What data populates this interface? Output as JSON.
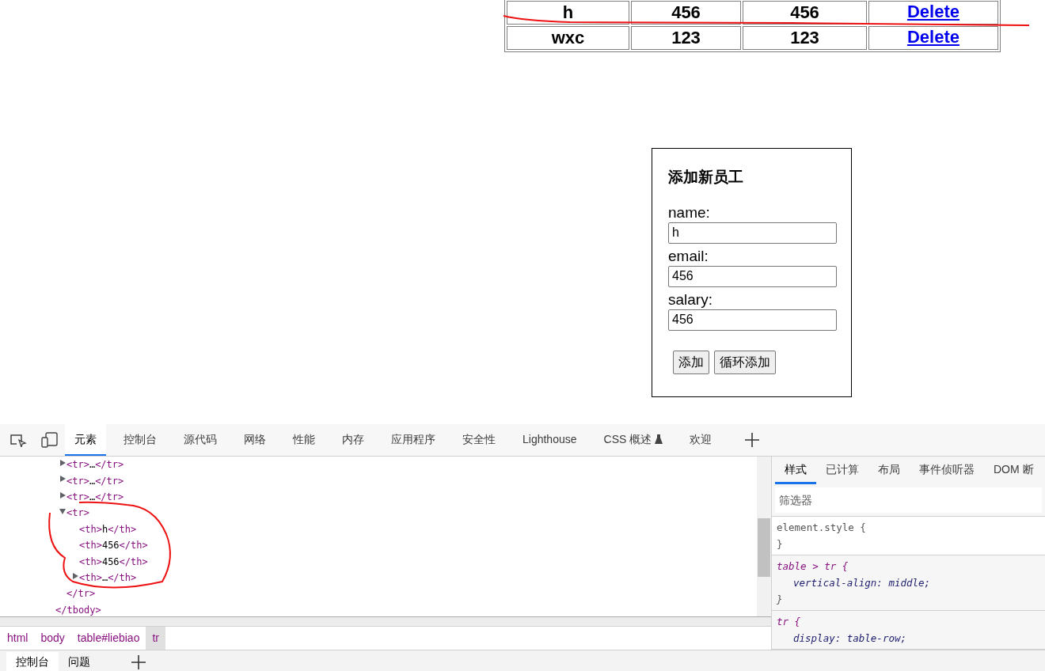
{
  "table": {
    "rows": [
      {
        "cells": [
          "h",
          "456",
          "456"
        ],
        "link": "Delete"
      },
      {
        "cells": [
          "wxc",
          "123",
          "123"
        ],
        "link": "Delete"
      }
    ]
  },
  "form": {
    "title": "添加新员工",
    "fields": [
      {
        "label": "name:",
        "value": "h"
      },
      {
        "label": "email:",
        "value": "456"
      },
      {
        "label": "salary:",
        "value": "456"
      }
    ],
    "buttons": [
      "添加",
      "循环添加"
    ]
  },
  "devtools": {
    "tabs": [
      {
        "label": "元素",
        "selected": true
      },
      {
        "label": "控制台",
        "selected": false
      },
      {
        "label": "源代码",
        "selected": false
      },
      {
        "label": "网络",
        "selected": false
      },
      {
        "label": "性能",
        "selected": false
      },
      {
        "label": "内存",
        "selected": false
      },
      {
        "label": "应用程序",
        "selected": false
      },
      {
        "label": "安全性",
        "selected": false
      },
      {
        "label": "Lighthouse",
        "selected": false
      },
      {
        "label": "CSS 概述",
        "selected": false
      },
      {
        "label": "欢迎",
        "selected": false
      }
    ],
    "dom_tree": {
      "children": [
        {
          "open": "<tr>",
          "content": "…",
          "close": "</tr>",
          "expanded": false
        },
        {
          "open": "<tr>",
          "content": "…",
          "close": "</tr>",
          "expanded": false
        },
        {
          "open": "<tr>",
          "content": "…",
          "close": "</tr>",
          "expanded": false
        },
        {
          "open": "<tr>",
          "close": "</tr>",
          "expanded": true,
          "children": [
            {
              "open": "<th>",
              "content": "h",
              "close": "</th>"
            },
            {
              "open": "<th>",
              "content": "456",
              "close": "</th>"
            },
            {
              "open": "<th>",
              "content": "456",
              "close": "</th>"
            },
            {
              "open": "<th>",
              "content": "…",
              "close": "</th>",
              "expanded": false
            }
          ]
        }
      ],
      "closing_tag": "</tbody>"
    },
    "breadcrumbs": [
      {
        "label": "html",
        "selected": false
      },
      {
        "label": "body",
        "selected": false
      },
      {
        "label": "table#liebiao",
        "selected": false
      },
      {
        "label": "tr",
        "selected": true
      }
    ],
    "styles_tabs": [
      {
        "label": "样式",
        "selected": true
      },
      {
        "label": "已计算",
        "selected": false
      },
      {
        "label": "布局",
        "selected": false
      },
      {
        "label": "事件侦听器",
        "selected": false
      },
      {
        "label": "DOM 断",
        "selected": false
      }
    ],
    "filter": {
      "placeholder": "筛选器"
    },
    "rules": [
      {
        "selector": "element.style {",
        "close": "}",
        "user_agent": false
      },
      {
        "selector": "table > tr {",
        "declarations": [
          "vertical-align: middle;"
        ],
        "close": "}",
        "user_agent": true
      },
      {
        "selector": "tr {",
        "declarations": [
          "display: table-row;"
        ],
        "user_agent": true
      }
    ],
    "drawer_tabs": [
      {
        "label": "控制台",
        "selected": true
      },
      {
        "label": "问题",
        "selected": false
      }
    ]
  }
}
